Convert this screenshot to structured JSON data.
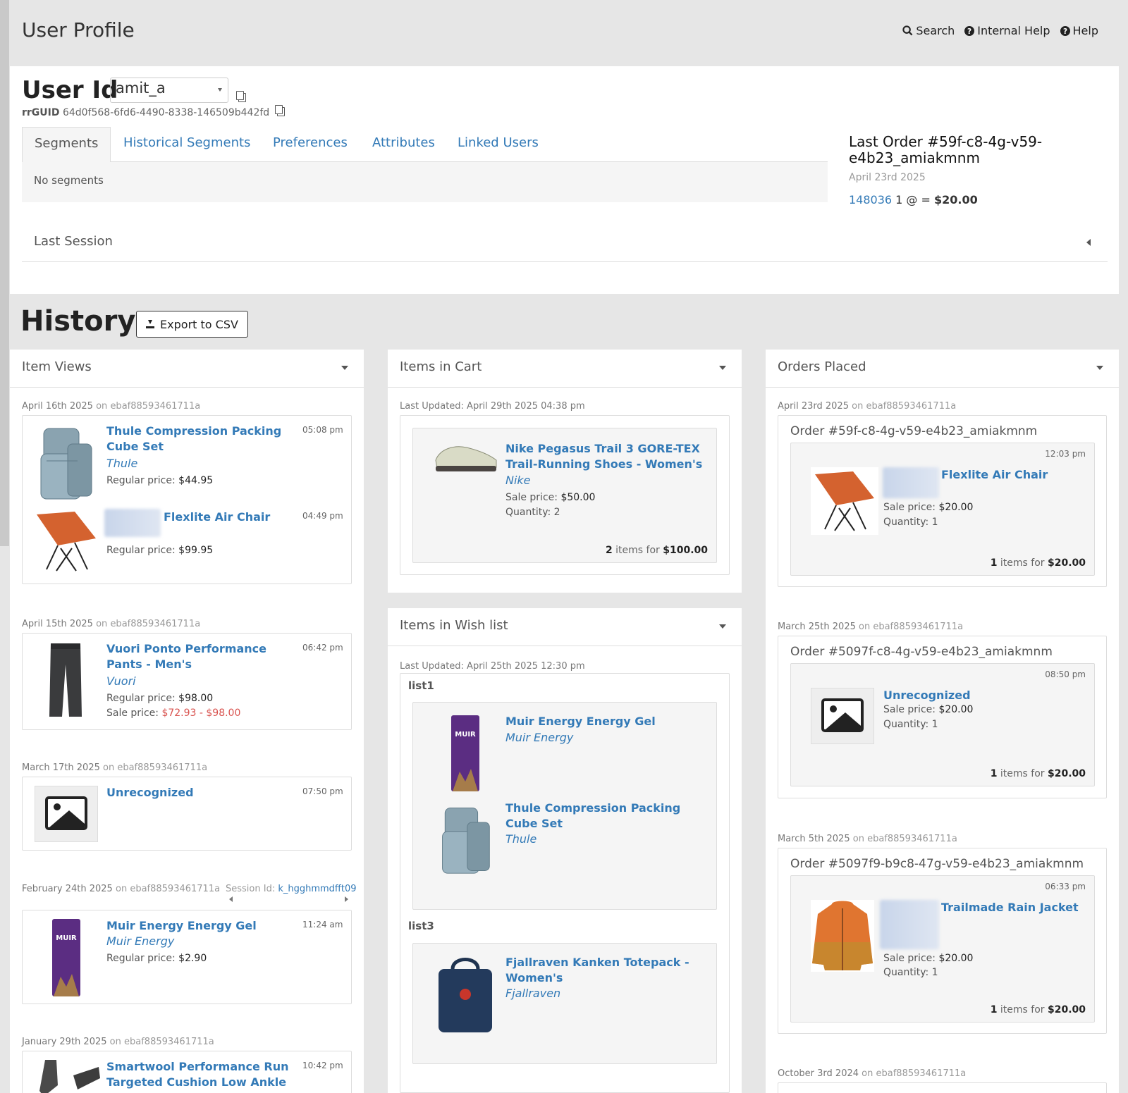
{
  "header": {
    "title": "User Profile",
    "nav": {
      "search": "Search",
      "internal_help": "Internal Help",
      "help": "Help"
    }
  },
  "user": {
    "id_label": "User Id",
    "id_value": "amit_a",
    "rrguid_label": "rrGUID",
    "rrguid_value": "64d0f568-6fd6-4490-8338-146509b442fd"
  },
  "tabs": [
    "Segments",
    "Historical Segments",
    "Preferences",
    "Attributes",
    "Linked Users"
  ],
  "segments_empty": "No segments",
  "last_order": {
    "title": "Last Order #59f-c8-4g-v59-e4b23_amiakmnm",
    "date": "April 23rd 2025",
    "item_link": "148036",
    "qty_text": " 1 @ = ",
    "amount": "$20.00"
  },
  "last_session": "Last Session",
  "history": {
    "title": "History",
    "export": "Export to CSV"
  },
  "item_views": {
    "title": "Item Views",
    "groups": [
      {
        "date": "April 16th 2025",
        "on": "on",
        "device": "ebaf88593461711a",
        "items": [
          {
            "title": "Thule Compression Packing Cube Set",
            "brand": "Thule",
            "price_label": "Regular price:",
            "price": "$44.95",
            "time": "05:08 pm"
          },
          {
            "title": "Flexlite Air Chair",
            "price_label": "Regular price:",
            "price": "$99.95",
            "time": "04:49 pm"
          }
        ]
      },
      {
        "date": "April 15th 2025",
        "on": "on",
        "device": "ebaf88593461711a",
        "items": [
          {
            "title": "Vuori Ponto Performance Pants - Men's",
            "brand": "Vuori",
            "price_label": "Regular price:",
            "price": "$98.00",
            "sale_label": "Sale price:",
            "sale": "$72.93 - $98.00",
            "time": "06:42 pm"
          }
        ]
      },
      {
        "date": "March 17th 2025",
        "on": "on",
        "device": "ebaf88593461711a",
        "items": [
          {
            "title": "Unrecognized",
            "time": "07:50 pm"
          }
        ]
      },
      {
        "date": "February 24th 2025",
        "on": "on",
        "device": "ebaf88593461711a",
        "session_label": "Session Id:",
        "session_id": "k_hgghmmdfft09",
        "items": [
          {
            "title": "Muir Energy Energy Gel",
            "brand": "Muir Energy",
            "price_label": "Regular price:",
            "price": "$2.90",
            "time": "11:24 am"
          }
        ]
      },
      {
        "date": "January 29th 2025",
        "on": "on",
        "device": "ebaf88593461711a",
        "items": [
          {
            "title": "Smartwool Performance Run Targeted Cushion Low Ankle Socks -",
            "time": "10:42 pm"
          }
        ]
      }
    ]
  },
  "cart": {
    "title": "Items in Cart",
    "updated": "Last Updated: April 29th 2025 04:38 pm",
    "item": {
      "title": "Nike Pegasus Trail 3 GORE-TEX Trail-Running Shoes - Women's",
      "brand": "Nike",
      "sale_label": "Sale price:",
      "sale": "$50.00",
      "qty": "Quantity: 2"
    },
    "summary_count": "2",
    "summary_text": " items for ",
    "summary_total": "$100.00"
  },
  "wishlist": {
    "title": "Items in Wish list",
    "updated": "Last Updated: April 25th 2025 12:30 pm",
    "lists": [
      {
        "name": "list1",
        "items": [
          {
            "title": "Muir Energy Energy Gel",
            "brand": "Muir Energy"
          },
          {
            "title": "Thule Compression Packing Cube Set",
            "brand": "Thule"
          }
        ]
      },
      {
        "name": "list3",
        "items": [
          {
            "title": "Fjallraven Kanken Totepack - Women's",
            "brand": "Fjallraven"
          }
        ]
      }
    ]
  },
  "orders": {
    "title": "Orders Placed",
    "list": [
      {
        "date": "April 23rd 2025",
        "on": "on",
        "device": "ebaf88593461711a",
        "order": "Order #59f-c8-4g-v59-e4b23_amiakmnm",
        "time": "12:03 pm",
        "item": "Flexlite Air Chair",
        "sale_label": "Sale price:",
        "sale": "$20.00",
        "qty": "Quantity: 1",
        "count": "1",
        "text": " items for ",
        "total": "$20.00"
      },
      {
        "date": "March 25th 2025",
        "on": "on",
        "device": "ebaf88593461711a",
        "order": "Order #5097f-c8-4g-v59-e4b23_amiakmnm",
        "time": "08:50 pm",
        "item": "Unrecognized",
        "sale_label": "Sale price:",
        "sale": "$20.00",
        "qty": "Quantity: 1",
        "count": "1",
        "text": " items for ",
        "total": "$20.00"
      },
      {
        "date": "March 5th 2025",
        "on": "on",
        "device": "ebaf88593461711a",
        "order": "Order #5097f9-b9c8-47g-v59-e4b23_amiakmnm",
        "time": "06:33 pm",
        "item": "Trailmade Rain Jacket",
        "sale_label": "Sale price:",
        "sale": "$20.00",
        "qty": "Quantity: 1",
        "count": "1",
        "text": " items for ",
        "total": "$20.00"
      },
      {
        "date": "October 3rd 2024",
        "on": "on",
        "device": "ebaf88593461711a"
      }
    ]
  }
}
